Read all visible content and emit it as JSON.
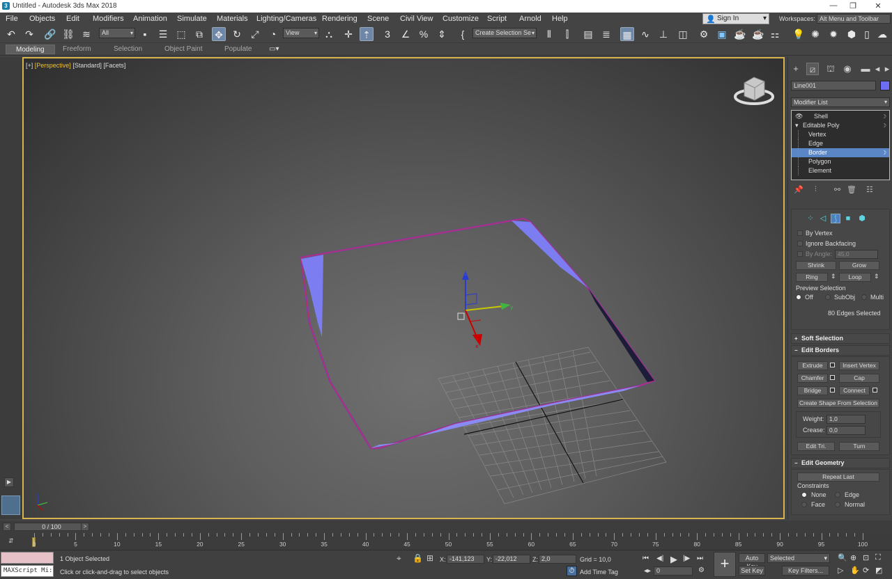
{
  "window": {
    "title": "Untitled - Autodesk 3ds Max 2018"
  },
  "menu": [
    "File",
    "Objects",
    "Edit",
    "Modifiers",
    "Animation",
    "Simulate",
    "Materials",
    "Lighting/Cameras",
    "Rendering",
    "Scene",
    "Civil View",
    "Customize",
    "Script",
    "Arnold",
    "Help"
  ],
  "signin": {
    "label": "Sign In"
  },
  "workspace": {
    "label": "Workspaces:",
    "value": "Alt Menu and Toolbar"
  },
  "toolbar": {
    "filter_value": "All",
    "refcoord_value": "View",
    "selection_set_placeholder": "Create Selection Se"
  },
  "ribbon_tabs": [
    "Modeling",
    "Freeform",
    "Selection",
    "Object Paint",
    "Populate"
  ],
  "viewport": {
    "label_plus": "[+]",
    "label_view": "[Perspective]",
    "label_shading": "[Standard]",
    "label_style": "[Facets]",
    "axis_x": "x",
    "axis_y": "y",
    "axis_z": "z"
  },
  "command_panel": {
    "object_name": "Line001",
    "object_color": "#6c6cf5",
    "modifier_list": "Modifier List",
    "stack": [
      {
        "label": "Shell",
        "level": 0,
        "selected": false
      },
      {
        "label": "Editable Poly",
        "level": 0,
        "selected": false
      },
      {
        "label": "Vertex",
        "level": 1,
        "selected": false
      },
      {
        "label": "Edge",
        "level": 1,
        "selected": false
      },
      {
        "label": "Border",
        "level": 1,
        "selected": true
      },
      {
        "label": "Polygon",
        "level": 1,
        "selected": false
      },
      {
        "label": "Element",
        "level": 1,
        "selected": false
      }
    ],
    "selection": {
      "by_vertex": "By Vertex",
      "ignore_backfacing": "Ignore Backfacing",
      "by_angle": "By Angle:",
      "by_angle_value": "45,0",
      "shrink": "Shrink",
      "grow": "Grow",
      "ring": "Ring",
      "loop": "Loop",
      "preview_selection": "Preview Selection",
      "off": "Off",
      "subobj": "SubObj",
      "multi": "Multi",
      "status": "80 Edges Selected"
    },
    "soft_selection": "Soft Selection",
    "edit_borders": {
      "title": "Edit Borders",
      "extrude": "Extrude",
      "insert_vertex": "Insert Vertex",
      "chamfer": "Chamfer",
      "cap": "Cap",
      "bridge": "Bridge",
      "connect": "Connect",
      "create_shape": "Create Shape From Selection",
      "weight_label": "Weight:",
      "weight_value": "1,0",
      "crease_label": "Crease:",
      "crease_value": "0,0",
      "edit_tri": "Edit Tri.",
      "turn": "Turn"
    },
    "edit_geometry": {
      "title": "Edit Geometry",
      "repeat_last": "Repeat Last",
      "constraints": "Constraints",
      "none": "None",
      "edge": "Edge",
      "face": "Face",
      "normal": "Normal"
    }
  },
  "timeline": {
    "frame_display": "0 / 100",
    "ticks": [
      0,
      5,
      10,
      15,
      20,
      25,
      30,
      35,
      40,
      45,
      50,
      55,
      60,
      65,
      70,
      75,
      80,
      85,
      90,
      95,
      100
    ]
  },
  "status": {
    "maxscript": "MAXScript Mi:",
    "objects_selected": "1 Object Selected",
    "prompt": "Click or click-and-drag to select objects",
    "x_label": "X:",
    "x_value": "-141,123",
    "y_label": "Y:",
    "y_value": "-22,012",
    "z_label": "Z:",
    "z_value": "2,0",
    "grid": "Grid = 10,0",
    "add_time_tag": "Add Time Tag",
    "auto_key": "Auto Key",
    "set_key": "Set Key",
    "key_mode": "Selected",
    "key_filters": "Key Filters...",
    "current_frame": "0"
  }
}
